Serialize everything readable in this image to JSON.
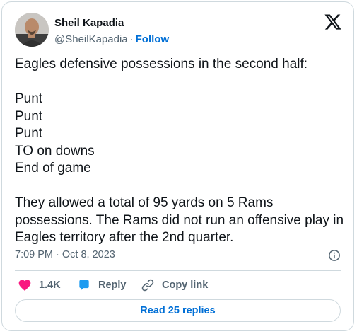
{
  "author": {
    "name": "Sheil Kapadia",
    "handle": "@SheilKapadia",
    "separator": "·",
    "follow_label": "Follow"
  },
  "tweet": {
    "text": "Eagles defensive possessions in the second half:\n\nPunt\nPunt\nPunt\nTO on downs\nEnd of game\n\nThey allowed a total of 95 yards on 5 Rams possessions. The Rams did not run an offensive play in Eagles territory after the 2nd quarter.",
    "timestamp": "7:09 PM · Oct 8, 2023"
  },
  "actions": {
    "like_count": "1.4K",
    "reply_label": "Reply",
    "copy_link_label": "Copy link"
  },
  "replies_button_label": "Read 25 replies",
  "colors": {
    "like": "#f91880",
    "reply": "#1d9bf0",
    "link": "#006fd6",
    "muted": "#536471",
    "border": "#cfd9de"
  },
  "icons": [
    "x-logo-icon",
    "info-icon",
    "heart-icon",
    "reply-bubble-icon",
    "link-icon"
  ]
}
